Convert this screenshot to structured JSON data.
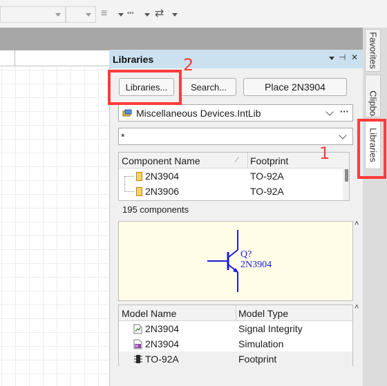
{
  "toolbar": {
    "icons": [
      "align-icon",
      "line-style-icon",
      "arrange-icon"
    ]
  },
  "panel": {
    "title": "Libraries",
    "pin_symbol": "⊣",
    "close_symbol": "✕",
    "libraries_button": "Libraries...",
    "search_button": "Search...",
    "place_button": "Place 2N3904",
    "library_selector": "Miscellaneous Devices.IntLib",
    "more_symbol": "···",
    "filter_value": "*",
    "components": {
      "columns": [
        "Component Name",
        "Footprint"
      ],
      "rows": [
        {
          "name": "2N3904",
          "footprint": "TO-92A"
        },
        {
          "name": "2N3906",
          "footprint": "TO-92A"
        }
      ],
      "count": "195 components"
    },
    "symbol_preview": {
      "designator": "Q?",
      "comment": "2N3904"
    },
    "models": {
      "columns": [
        "Model Name",
        "Model Type"
      ],
      "rows": [
        {
          "name": "2N3904",
          "type": "Signal Integrity",
          "icon": "signal-integrity-icon"
        },
        {
          "name": "2N3904",
          "type": "Simulation",
          "icon": "simulation-icon"
        },
        {
          "name": "TO-92A",
          "type": "Footprint",
          "icon": "footprint-icon"
        }
      ]
    }
  },
  "side_tabs": [
    "Favorites",
    "Clipboard",
    "Libraries"
  ],
  "annotations": {
    "step1": "1",
    "step2": "2"
  },
  "colors": {
    "title_bar": "#cbe1f0",
    "annotation_red": "#ff3b3b",
    "preview_bg": "#fffde8",
    "transistor_blue": "#1b1bd6"
  }
}
